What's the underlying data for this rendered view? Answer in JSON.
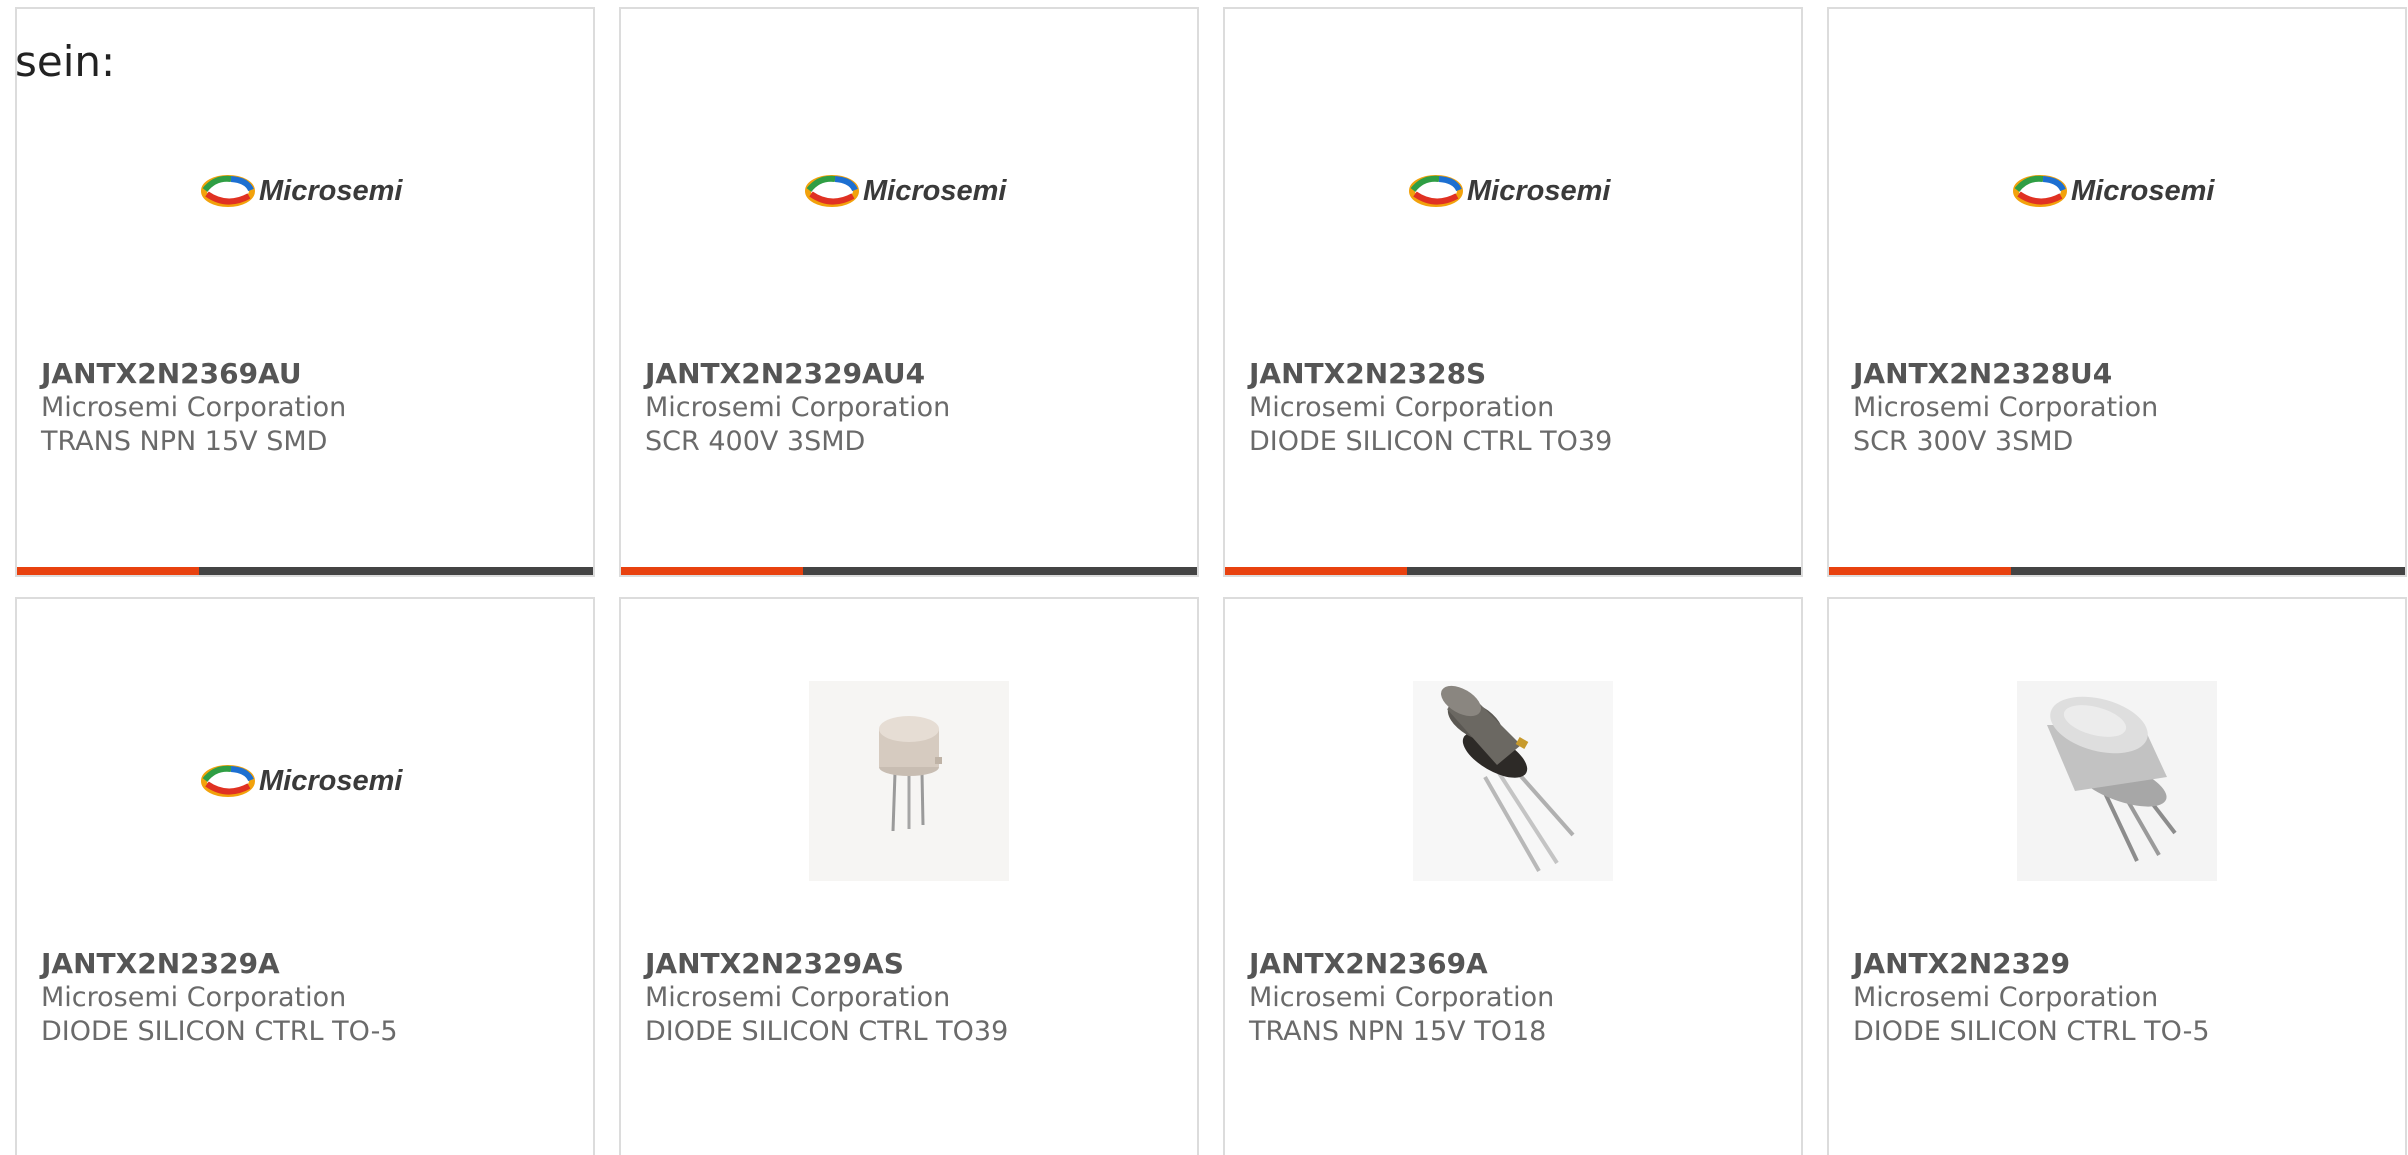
{
  "intro_text": "sein:",
  "colors": {
    "accent": "#e8410f",
    "bar": "#444444",
    "border": "#dcdcdc",
    "part_text": "#555555",
    "meta_text": "#6a6a6a"
  },
  "cards": [
    {
      "part": "JANTX2N2369AU",
      "manufacturer": "Microsemi Corporation",
      "description": "TRANS NPN 15V SMD",
      "image": "microsemi-logo",
      "logo_text": "Microsemi"
    },
    {
      "part": "JANTX2N2329AU4",
      "manufacturer": "Microsemi Corporation",
      "description": "SCR 400V 3SMD",
      "image": "microsemi-logo",
      "logo_text": "Microsemi"
    },
    {
      "part": "JANTX2N2328S",
      "manufacturer": "Microsemi Corporation",
      "description": "DIODE SILICON CTRL TO39",
      "image": "microsemi-logo",
      "logo_text": "Microsemi"
    },
    {
      "part": "JANTX2N2328U4",
      "manufacturer": "Microsemi Corporation",
      "description": "SCR 300V 3SMD",
      "image": "microsemi-logo",
      "logo_text": "Microsemi"
    },
    {
      "part": "JANTX2N2329A",
      "manufacturer": "Microsemi Corporation",
      "description": "DIODE SILICON CTRL TO-5",
      "image": "microsemi-logo",
      "logo_text": "Microsemi"
    },
    {
      "part": "JANTX2N2329AS",
      "manufacturer": "Microsemi Corporation",
      "description": "DIODE SILICON CTRL TO39",
      "image": "to39-can-photo"
    },
    {
      "part": "JANTX2N2369A",
      "manufacturer": "Microsemi Corporation",
      "description": "TRANS NPN 15V TO18",
      "image": "to18-dark-can-photo"
    },
    {
      "part": "JANTX2N2329",
      "manufacturer": "Microsemi Corporation",
      "description": "DIODE SILICON CTRL TO-5",
      "image": "to5-can-photo"
    }
  ]
}
